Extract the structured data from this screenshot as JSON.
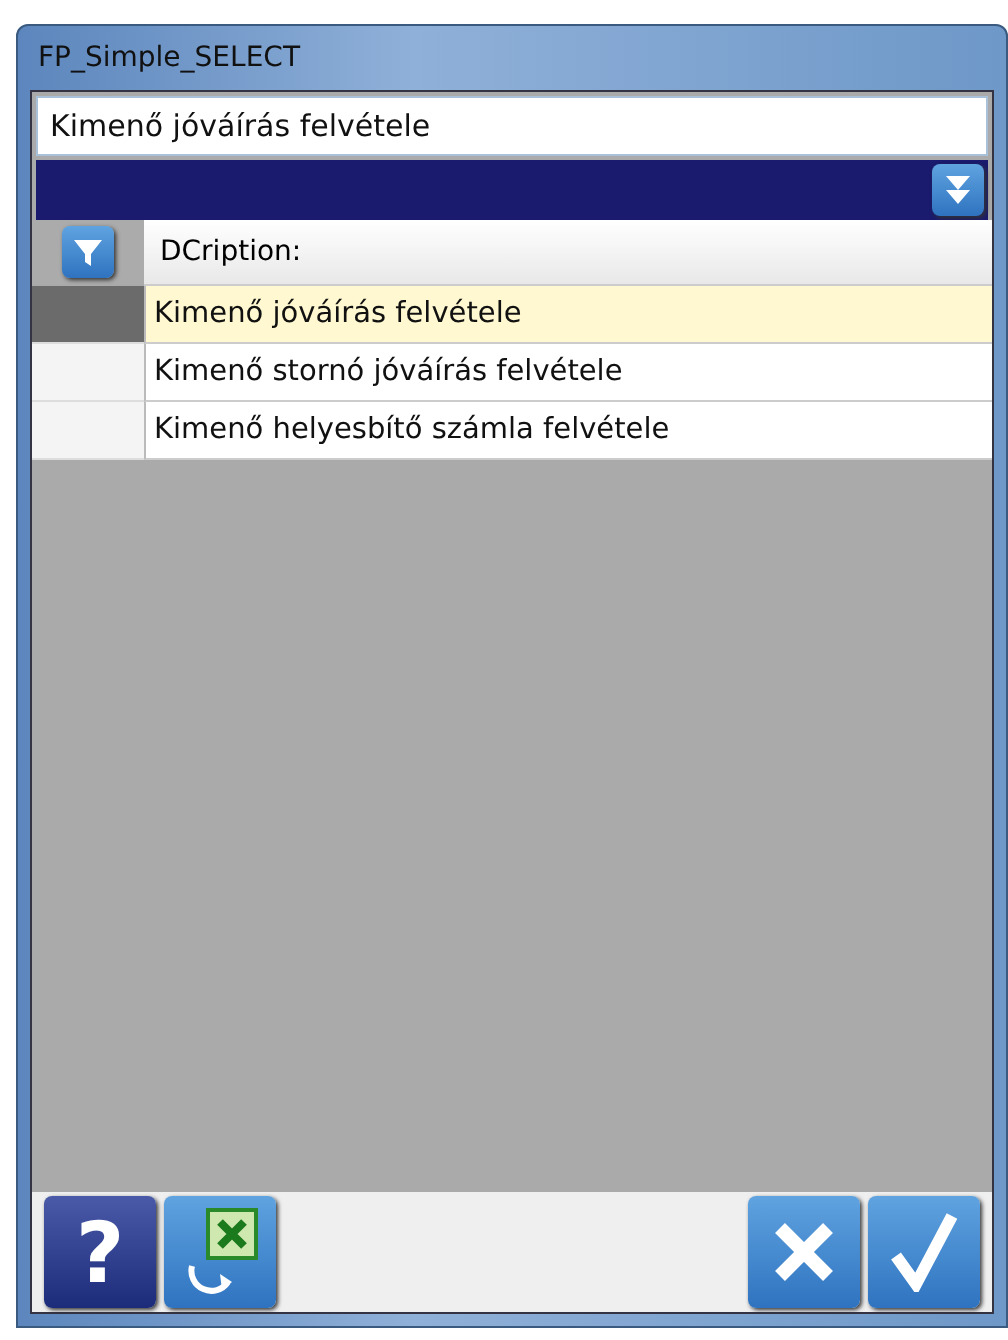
{
  "window": {
    "title": "FP_Simple_SELECT"
  },
  "search": {
    "value": "Kimenő jóváírás felvétele"
  },
  "table": {
    "columns": [
      "DCription:"
    ],
    "rows": [
      {
        "cells": [
          "Kimenő jóváírás felvétele"
        ],
        "selected": true
      },
      {
        "cells": [
          "Kimenő stornó jóváírás felvétele"
        ],
        "selected": false
      },
      {
        "cells": [
          "Kimenő helyesbítő számla felvétele"
        ],
        "selected": false
      }
    ]
  },
  "toolbar": {
    "help_label": "?"
  }
}
